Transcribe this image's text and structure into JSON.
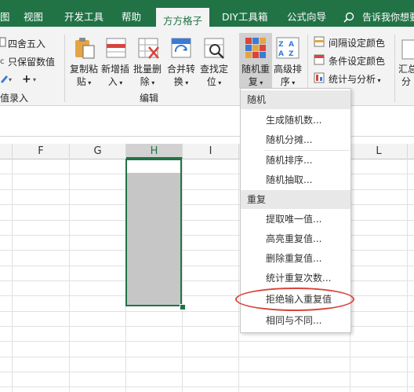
{
  "tabs": {
    "t0": "图",
    "t1": "视图",
    "t2": "开发工具",
    "t3": "帮助",
    "t4": "方方格子",
    "t5": "DIY工具箱",
    "t6": "公式向导",
    "tellme": "告诉我你想要"
  },
  "ribbon": {
    "left": {
      "round": "四舍五入",
      "keep": "只保留数值",
      "entry": "值录入"
    },
    "buttons": {
      "copy_paste": [
        "复制粘",
        "贴"
      ],
      "add_insert": [
        "新增插",
        "入"
      ],
      "batch_delete": [
        "批量删",
        "除"
      ],
      "merge_convert": [
        "合并转",
        "换"
      ],
      "find_locate": [
        "查找定",
        "位"
      ],
      "random_repeat": [
        "随机重",
        "复"
      ],
      "advanced_sort": [
        "高级排",
        "序"
      ]
    },
    "group_edit": "编辑",
    "right": {
      "interval_color": "间隔设定颜色",
      "cond_color": "条件设定颜色",
      "stats": "统计与分析"
    },
    "far_right": [
      "汇总",
      "分"
    ]
  },
  "columns": [
    "F",
    "G",
    "H",
    "I",
    "L"
  ],
  "menu": {
    "section1": "随机",
    "items1": [
      "生成随机数...",
      "随机分摊...",
      "随机排序...",
      "随机抽取..."
    ],
    "section2": "重复",
    "items2": [
      "提取唯一值...",
      "高亮重复值...",
      "删除重复值...",
      "统计重复次数...",
      "拒绝输入重复值",
      "相同与不同..."
    ]
  },
  "colors": {
    "accent": "#217346",
    "highlight_ring": "#d9443b"
  }
}
